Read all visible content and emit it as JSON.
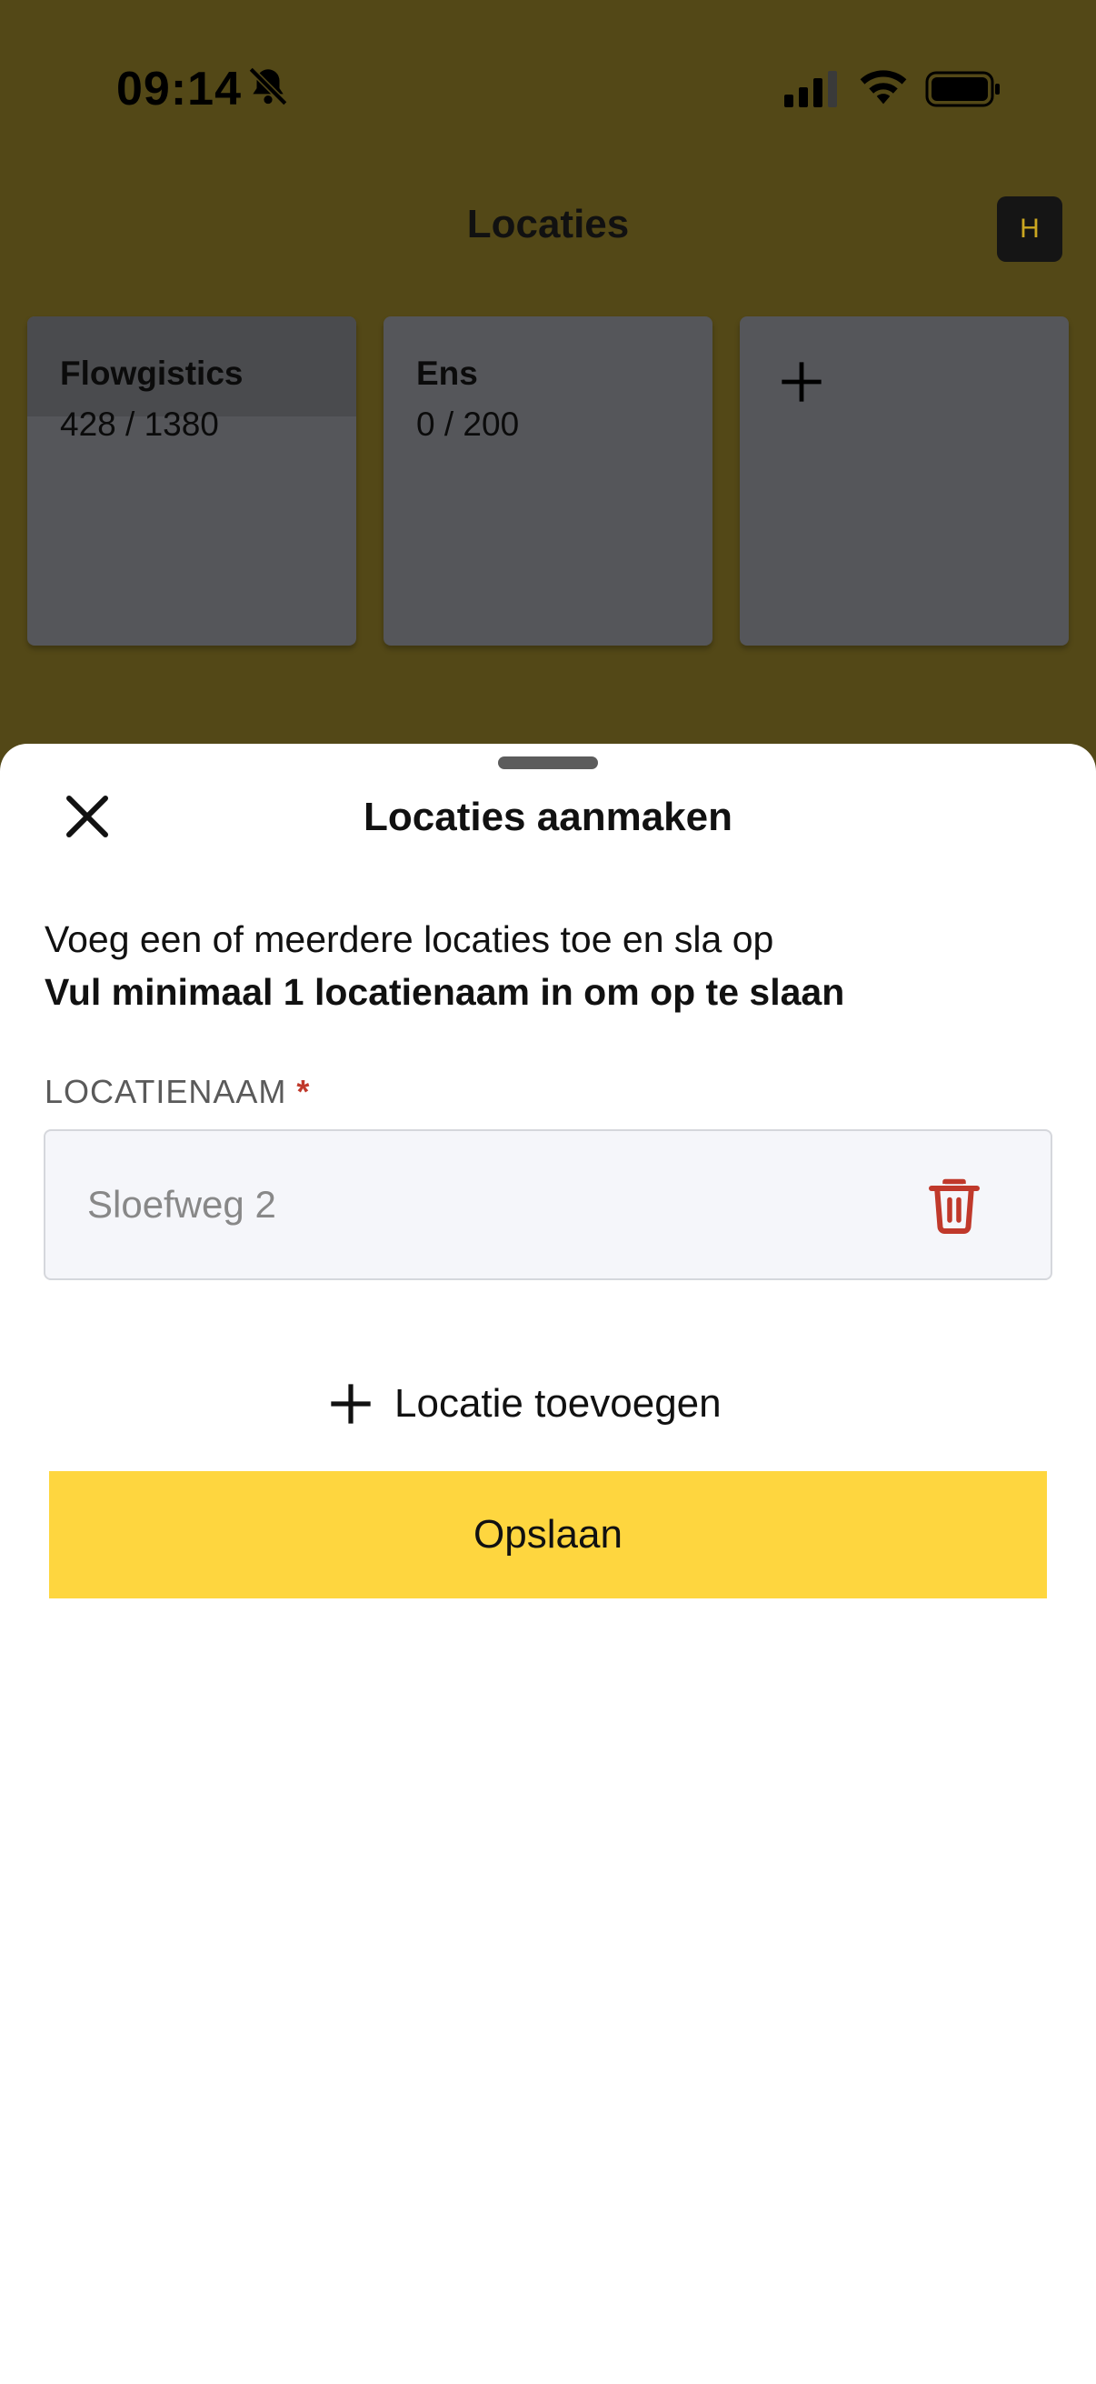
{
  "status_bar": {
    "time": "09:14",
    "bell_icon": "bell-slash-icon",
    "signal_icon": "cellular-signal-icon",
    "wifi_icon": "wifi-icon",
    "battery_icon": "battery-icon"
  },
  "header": {
    "title": "Locaties",
    "avatar_initial": "H"
  },
  "cards": [
    {
      "name": "Flowgistics",
      "count": "428 / 1380"
    },
    {
      "name": "Ens",
      "count": "0 / 200"
    }
  ],
  "add_card": {
    "icon": "plus-icon"
  },
  "sheet": {
    "title": "Locaties aanmaken",
    "close_icon": "close-icon",
    "description": "Voeg een of meerdere locaties toe en sla op",
    "description_bold": "Vul minimaal 1 locatienaam in om op te slaan",
    "field_label": "LOCATIENAAM",
    "required_marker": "*",
    "input_placeholder": "Sloefweg 2",
    "input_value": "",
    "delete_icon": "trash-icon",
    "add_location_label": "Locatie toevoegen",
    "save_label": "Opslaan"
  },
  "colors": {
    "backdrop": "#534817",
    "accent": "#fed63f",
    "danger": "#c0392b",
    "card": "#55565a"
  }
}
